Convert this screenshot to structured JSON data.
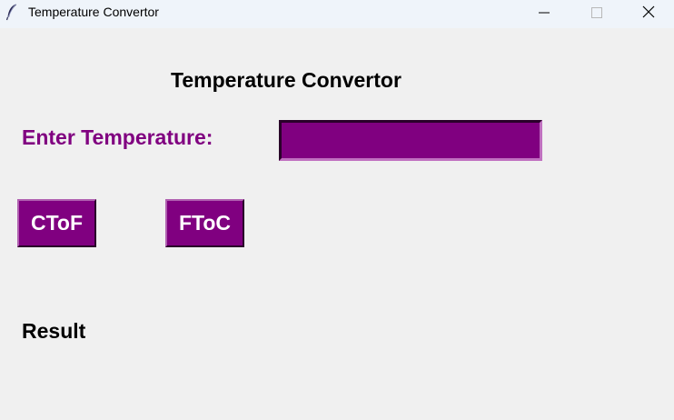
{
  "window": {
    "title": "Temperature Convertor",
    "app_icon": "feather-icon",
    "controls": [
      "minimize-icon",
      "maximize-icon",
      "close-icon"
    ]
  },
  "main": {
    "heading": "Temperature Convertor",
    "prompt_label": "Enter Temperature:",
    "temperature_input": {
      "value": "",
      "placeholder": ""
    },
    "buttons": {
      "ctof_label": "CToF",
      "ftoc_label": "FToC"
    },
    "result_label": "Result"
  },
  "colors": {
    "accent": "#800080",
    "button_text": "#ffffff",
    "background": "#f0f0f0",
    "titlebar": "#eff4fa"
  }
}
